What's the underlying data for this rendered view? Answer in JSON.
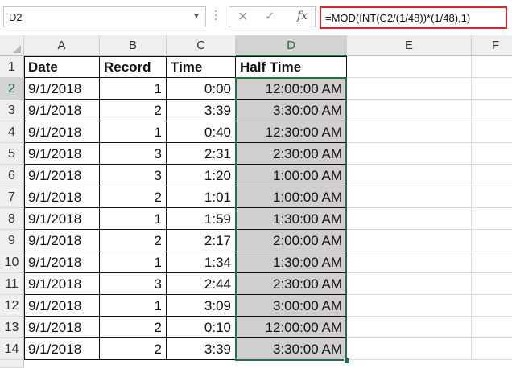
{
  "name_box": {
    "value": "D2"
  },
  "formula_bar": {
    "cancel_glyph": "✕",
    "enter_glyph": "✓",
    "fx_glyph": "fx",
    "formula": "=MOD(INT(C2/(1/48))*(1/48),1)"
  },
  "columns": [
    "A",
    "B",
    "C",
    "D",
    "E",
    "F"
  ],
  "rows": [
    "1",
    "2",
    "3",
    "4",
    "5",
    "6",
    "7",
    "8",
    "9",
    "10",
    "11",
    "12",
    "13",
    "14"
  ],
  "selected_cell": "D2",
  "headers": {
    "date": "Date",
    "record": "Record",
    "time": "Time",
    "half_time": "Half Time"
  },
  "data_rows": [
    {
      "date": "9/1/2018",
      "record": "1",
      "time": "0:00",
      "half_time": "12:00:00 AM"
    },
    {
      "date": "9/1/2018",
      "record": "2",
      "time": "3:39",
      "half_time": "3:30:00 AM"
    },
    {
      "date": "9/1/2018",
      "record": "1",
      "time": "0:40",
      "half_time": "12:30:00 AM"
    },
    {
      "date": "9/1/2018",
      "record": "3",
      "time": "2:31",
      "half_time": "2:30:00 AM"
    },
    {
      "date": "9/1/2018",
      "record": "3",
      "time": "1:20",
      "half_time": "1:00:00 AM"
    },
    {
      "date": "9/1/2018",
      "record": "2",
      "time": "1:01",
      "half_time": "1:00:00 AM"
    },
    {
      "date": "9/1/2018",
      "record": "1",
      "time": "1:59",
      "half_time": "1:30:00 AM"
    },
    {
      "date": "9/1/2018",
      "record": "2",
      "time": "2:17",
      "half_time": "2:00:00 AM"
    },
    {
      "date": "9/1/2018",
      "record": "1",
      "time": "1:34",
      "half_time": "1:30:00 AM"
    },
    {
      "date": "9/1/2018",
      "record": "3",
      "time": "2:44",
      "half_time": "2:30:00 AM"
    },
    {
      "date": "9/1/2018",
      "record": "1",
      "time": "3:09",
      "half_time": "3:00:00 AM"
    },
    {
      "date": "9/1/2018",
      "record": "2",
      "time": "0:10",
      "half_time": "12:00:00 AM"
    },
    {
      "date": "9/1/2018",
      "record": "2",
      "time": "3:39",
      "half_time": "3:30:00 AM"
    }
  ],
  "colors": {
    "selection": "#217346",
    "formula_highlight": "#e0242c",
    "shaded_fill": "#d0cece"
  }
}
